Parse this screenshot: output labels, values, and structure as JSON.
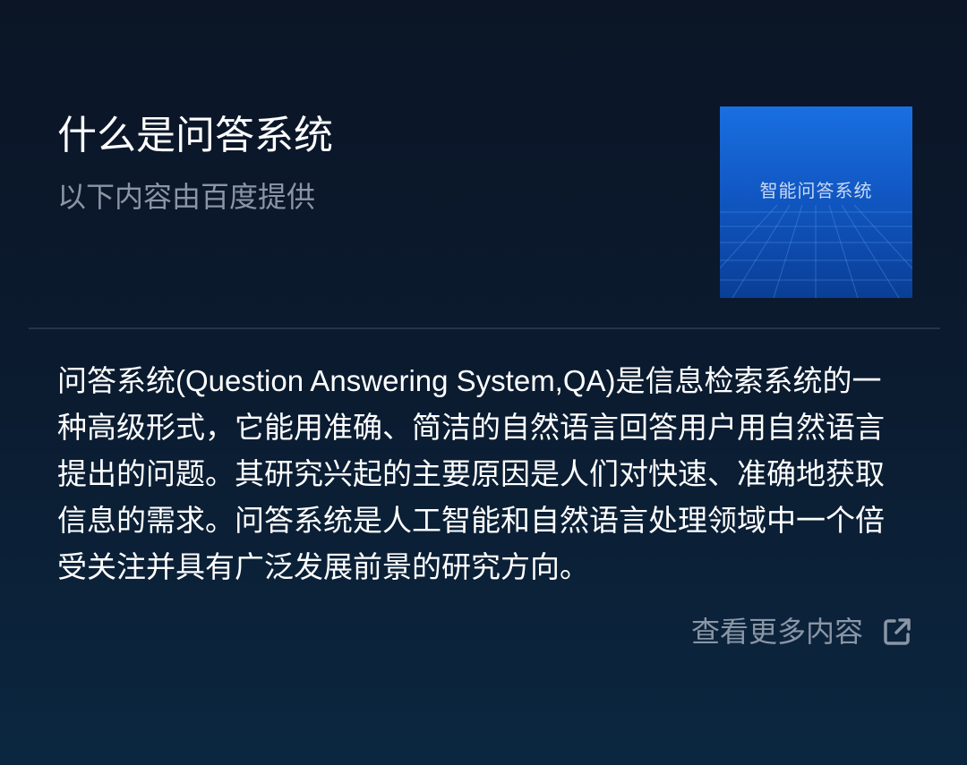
{
  "header": {
    "title": "什么是问答系统",
    "subtitle": "以下内容由百度提供"
  },
  "thumbnail": {
    "label": "智能问答系统"
  },
  "content": {
    "text": "问答系统(Question Answering System,QA)是信息检索系统的一种高级形式，它能用准确、简洁的自然语言回答用户用自然语言提出的问题。其研究兴起的主要原因是人们对快速、准确地获取信息的需求。问答系统是人工智能和自然语言处理领域中一个倍受关注并具有广泛发展前景的研究方向。"
  },
  "more_link": {
    "label": "查看更多内容",
    "icon": "external-link-icon"
  },
  "colors": {
    "background_top": "#0b1526",
    "background_bottom": "#0b2740",
    "secondary_text": "#8a96a6",
    "thumbnail_blue": "#1a6fe0"
  }
}
